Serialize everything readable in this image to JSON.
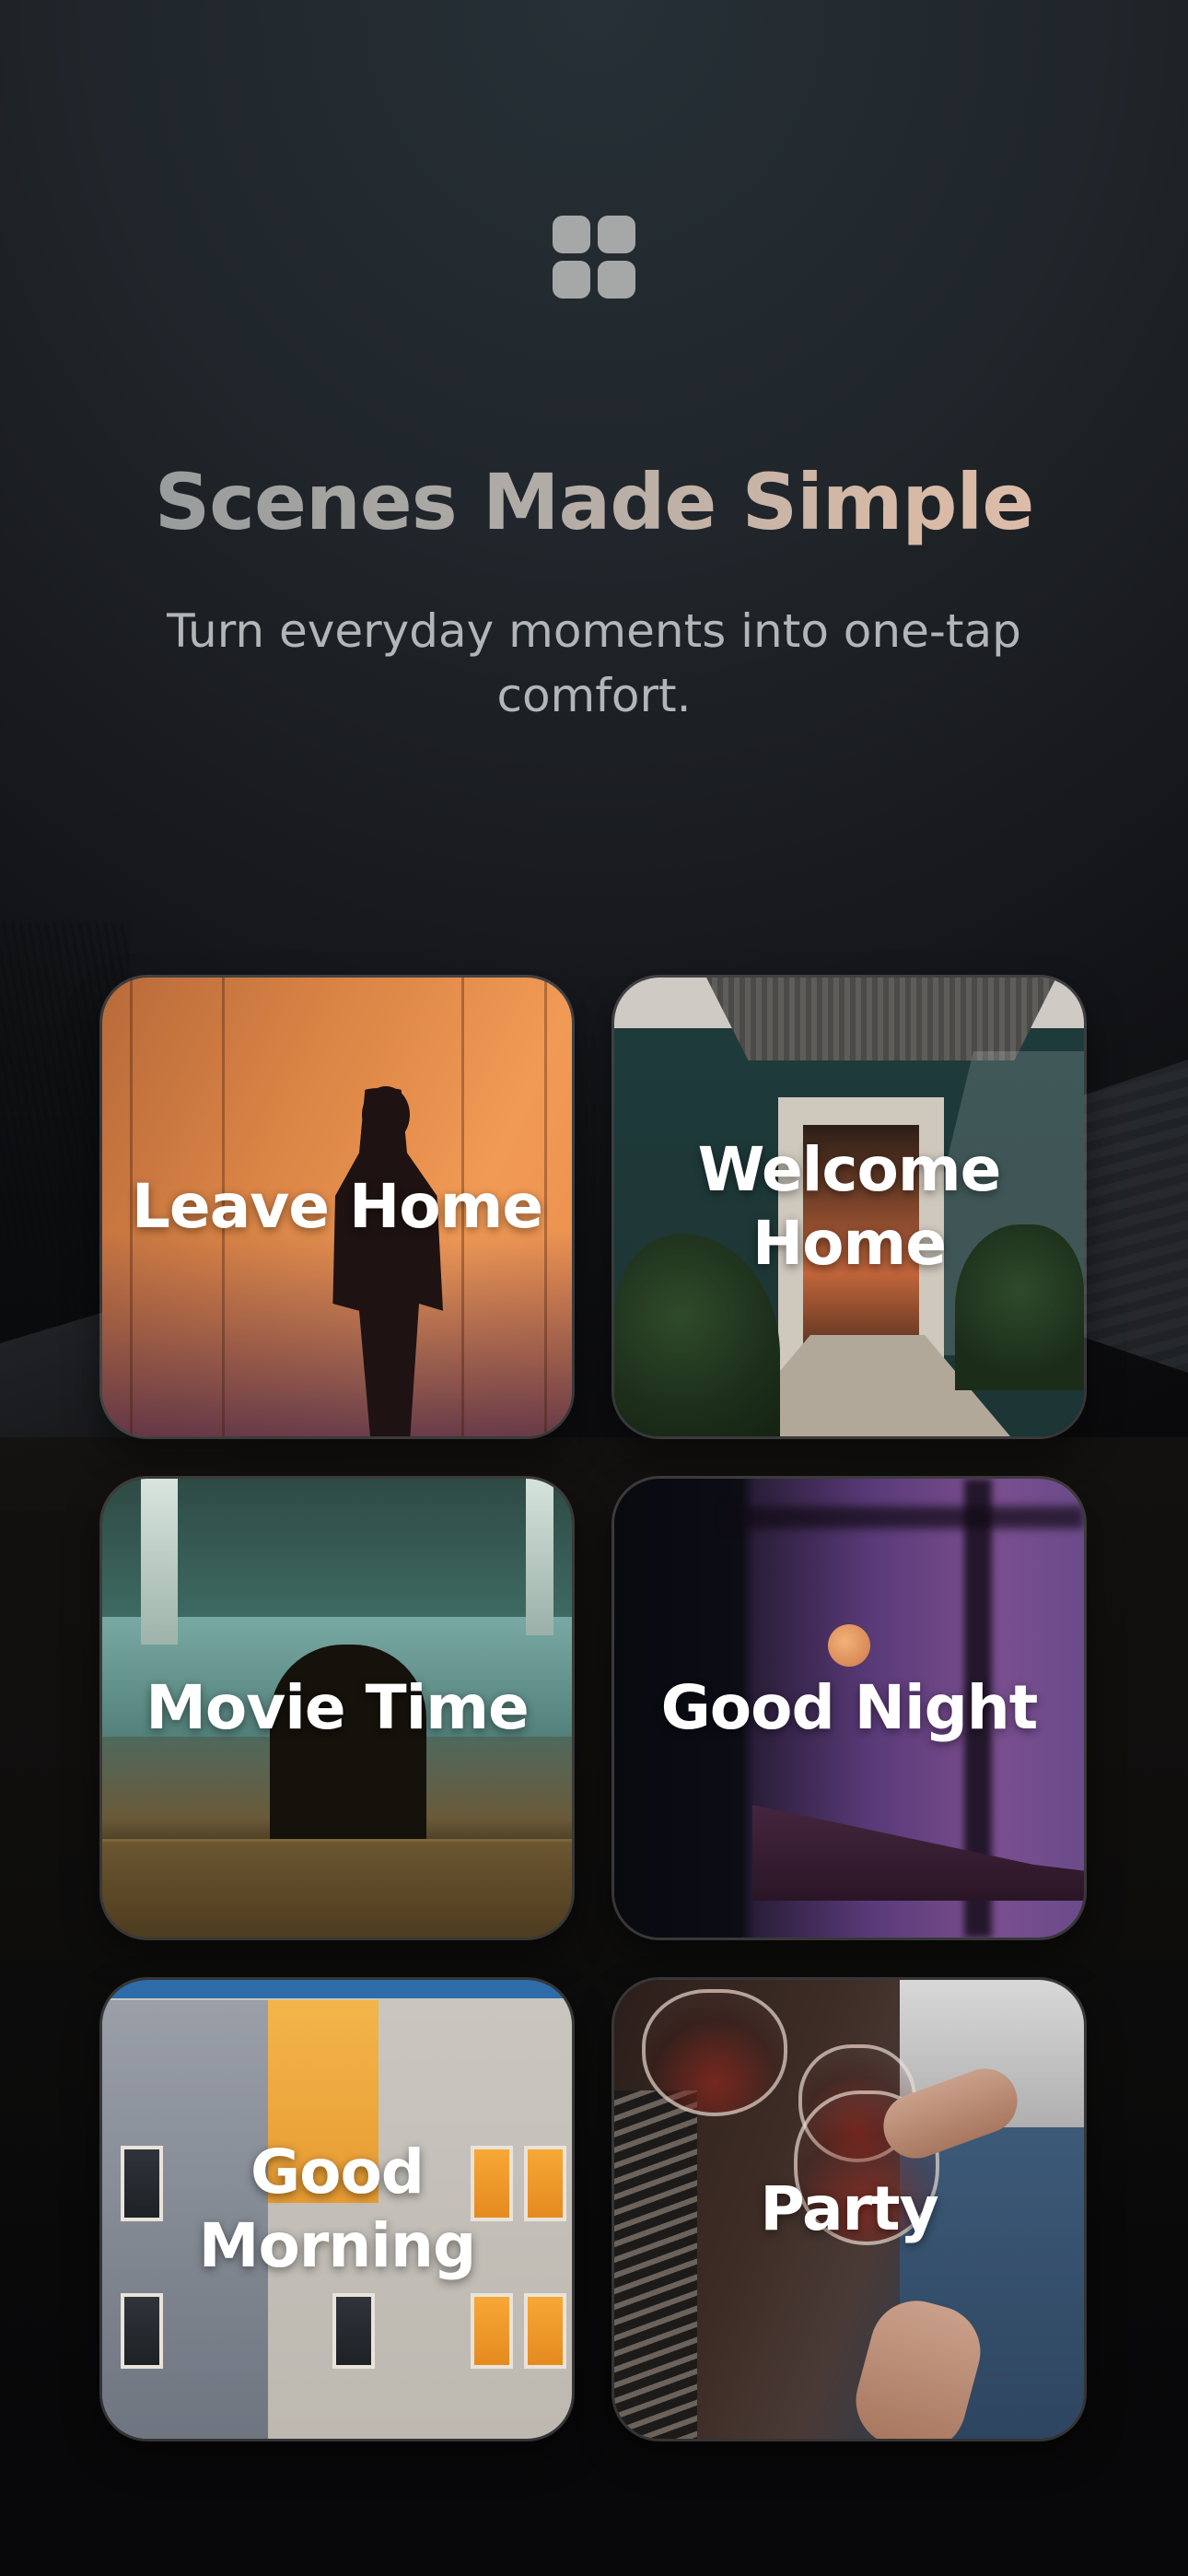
{
  "app": {
    "logo_icon": "grid-four-squares-icon",
    "title": "Scenes Made Simple",
    "subtitle": "Turn everyday moments into one-tap comfort."
  },
  "colors": {
    "background_top": "#263036",
    "background_bottom": "#0a0a0c",
    "title_gradient_start": "#8e9697",
    "title_gradient_end": "#e3c0aa",
    "subtitle": "#b3b6b8",
    "card_label": "#ffffff"
  },
  "scenes": [
    {
      "label": "Leave Home"
    },
    {
      "label": "Welcome Home"
    },
    {
      "label": "Movie Time"
    },
    {
      "label": "Good Night"
    },
    {
      "label": "Good Morning"
    },
    {
      "label": "Party"
    }
  ]
}
